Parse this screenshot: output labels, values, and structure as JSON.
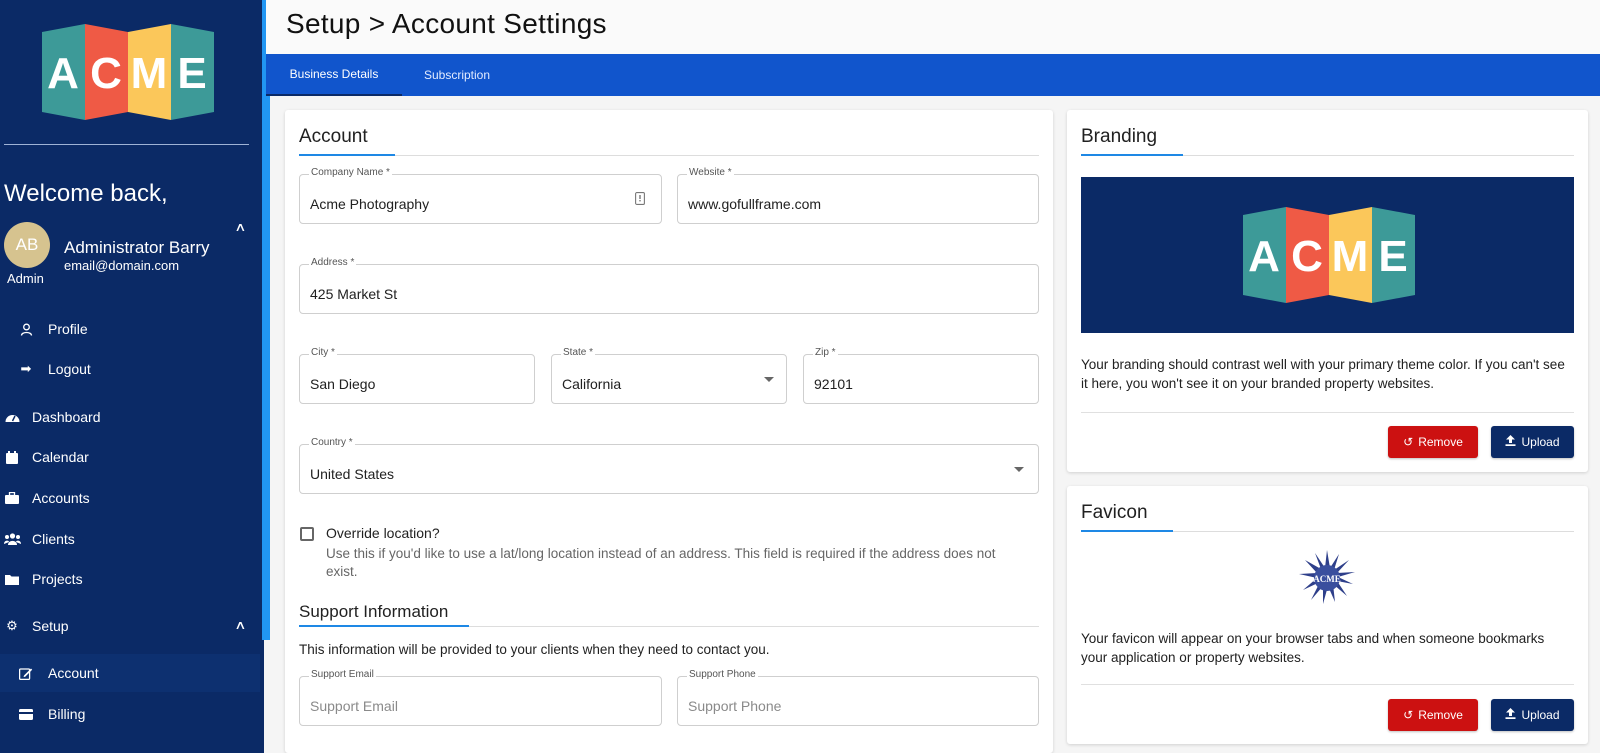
{
  "sidebar": {
    "logo_text": "ACME",
    "welcome": "Welcome back,",
    "user": {
      "initials": "AB",
      "name": "Administrator Barry",
      "email": "email@domain.com",
      "role": "Admin"
    },
    "items": [
      {
        "label": "Profile",
        "icon": "user-icon"
      },
      {
        "label": "Logout",
        "icon": "logout-icon"
      },
      {
        "label": "Dashboard",
        "icon": "dashboard-icon"
      },
      {
        "label": "Calendar",
        "icon": "calendar-icon"
      },
      {
        "label": "Accounts",
        "icon": "briefcase-icon"
      },
      {
        "label": "Clients",
        "icon": "users-icon"
      },
      {
        "label": "Projects",
        "icon": "folder-icon"
      },
      {
        "label": "Setup",
        "icon": "gear-icon"
      },
      {
        "label": "Account",
        "icon": "edit-icon"
      },
      {
        "label": "Billing",
        "icon": "credit-card-icon"
      }
    ]
  },
  "header": {
    "title": "Setup > Account Settings"
  },
  "tabs": [
    {
      "label": "Business Details",
      "active": true
    },
    {
      "label": "Subscription",
      "active": false
    }
  ],
  "account": {
    "title": "Account",
    "company_name": {
      "label": "Company Name *",
      "value": "Acme Photography"
    },
    "website": {
      "label": "Website *",
      "value": "www.gofullframe.com"
    },
    "address": {
      "label": "Address *",
      "value": "425 Market St"
    },
    "city": {
      "label": "City *",
      "value": "San Diego"
    },
    "state": {
      "label": "State *",
      "value": "California"
    },
    "zip": {
      "label": "Zip *",
      "value": "92101"
    },
    "country": {
      "label": "Country *",
      "value": "United States"
    },
    "override": {
      "label": "Override location?",
      "help": "Use this if you'd like to use a lat/long location instead of an address. This field is required if the address does not exist.",
      "checked": false
    }
  },
  "support": {
    "title": "Support Information",
    "description": "This information will be provided to your clients when they need to contact you.",
    "email": {
      "label": "Support Email",
      "placeholder": "Support Email"
    },
    "phone": {
      "label": "Support Phone",
      "placeholder": "Support Phone"
    }
  },
  "branding": {
    "title": "Branding",
    "logo_text": "ACME",
    "description": "Your branding should contrast well with your primary theme color. If you can't see it here, you won't see it on your branded property websites.",
    "remove_label": "Remove",
    "upload_label": "Upload"
  },
  "favicon": {
    "title": "Favicon",
    "badge_text": "ACME",
    "description": "Your favicon will appear on your browser tabs and when someone bookmarks your application or property websites.",
    "remove_label": "Remove",
    "upload_label": "Upload"
  },
  "colors": {
    "sidebar": "#0b2a66",
    "tabbar": "#1155cc",
    "accent": "#1e88e5",
    "danger": "#cc1111",
    "logo_teal": "#3d9a98",
    "logo_red": "#ef5a45",
    "logo_yellow": "#fbc75a"
  }
}
